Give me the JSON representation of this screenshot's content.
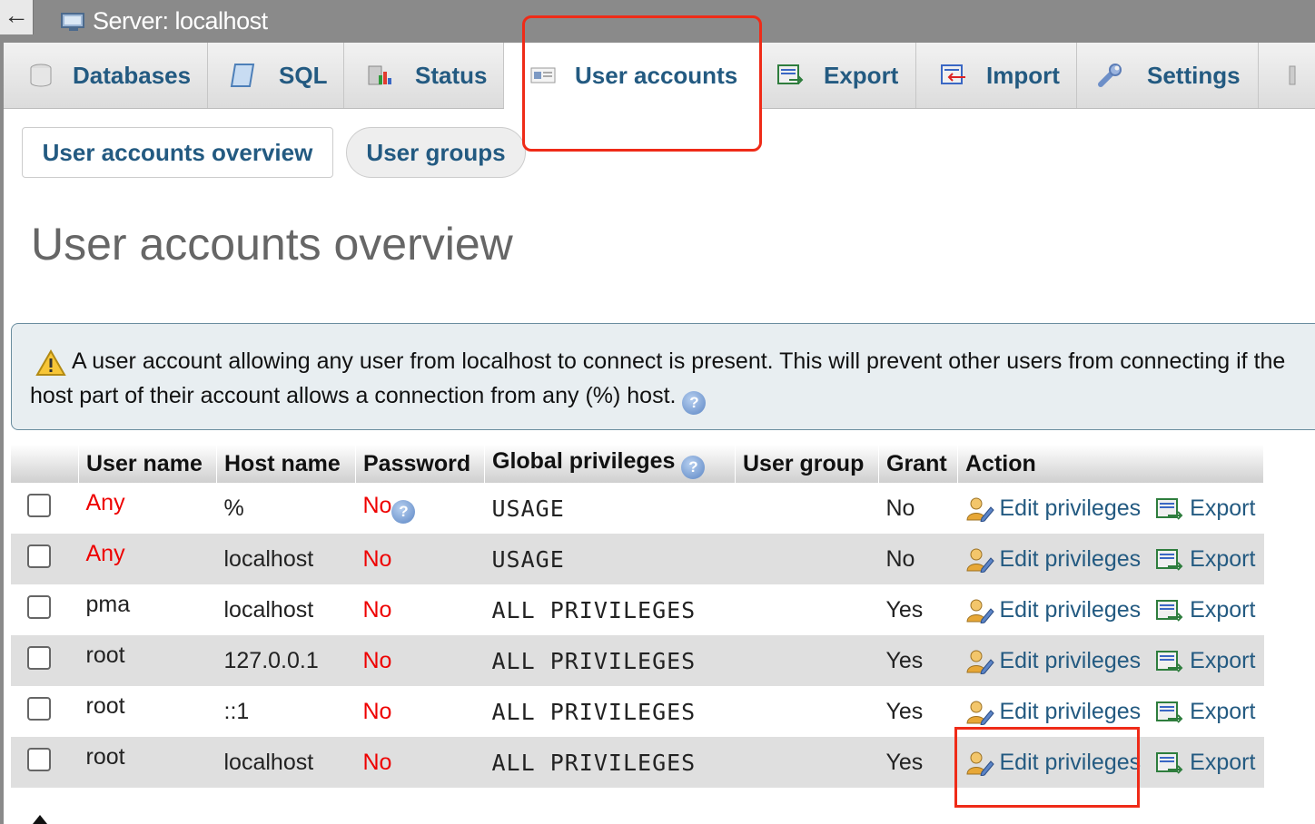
{
  "window": {
    "server_title": "Server: localhost"
  },
  "tabs": [
    {
      "label": "Databases",
      "icon": "database-icon"
    },
    {
      "label": "SQL",
      "icon": "sql-icon"
    },
    {
      "label": "Status",
      "icon": "status-chart-icon"
    },
    {
      "label": "User accounts",
      "icon": "user-accounts-icon",
      "active": true
    },
    {
      "label": "Export",
      "icon": "export-icon"
    },
    {
      "label": "Import",
      "icon": "import-icon"
    },
    {
      "label": "Settings",
      "icon": "wrench-icon"
    }
  ],
  "subtabs": {
    "overview": "User accounts overview",
    "groups": "User groups"
  },
  "page": {
    "title": "User accounts overview"
  },
  "notice": {
    "text": "A user account allowing any user from localhost to connect is present. This will prevent other users from connecting if the host part of their account allows a connection from any (%) host."
  },
  "table": {
    "headers": {
      "username": "User name",
      "hostname": "Host name",
      "password": "Password",
      "global": "Global privileges",
      "usergroup": "User group",
      "grant": "Grant",
      "action": "Action"
    },
    "edit_label": "Edit privileges",
    "export_label": "Export",
    "rows": [
      {
        "user": "Any",
        "host": "%",
        "password": "No",
        "privileges": "USAGE",
        "group": "",
        "grant": "No"
      },
      {
        "user": "Any",
        "host": "localhost",
        "password": "No",
        "privileges": "USAGE",
        "group": "",
        "grant": "No"
      },
      {
        "user": "pma",
        "host": "localhost",
        "password": "No",
        "privileges": "ALL PRIVILEGES",
        "group": "",
        "grant": "Yes"
      },
      {
        "user": "root",
        "host": "127.0.0.1",
        "password": "No",
        "privileges": "ALL PRIVILEGES",
        "group": "",
        "grant": "Yes"
      },
      {
        "user": "root",
        "host": "::1",
        "password": "No",
        "privileges": "ALL PRIVILEGES",
        "group": "",
        "grant": "Yes"
      },
      {
        "user": "root",
        "host": "localhost",
        "password": "No",
        "privileges": "ALL PRIVILEGES",
        "group": "",
        "grant": "Yes"
      }
    ]
  },
  "colors": {
    "link": "#235a81",
    "highlight": "#ef2b18",
    "warning_text": "#e00000"
  }
}
